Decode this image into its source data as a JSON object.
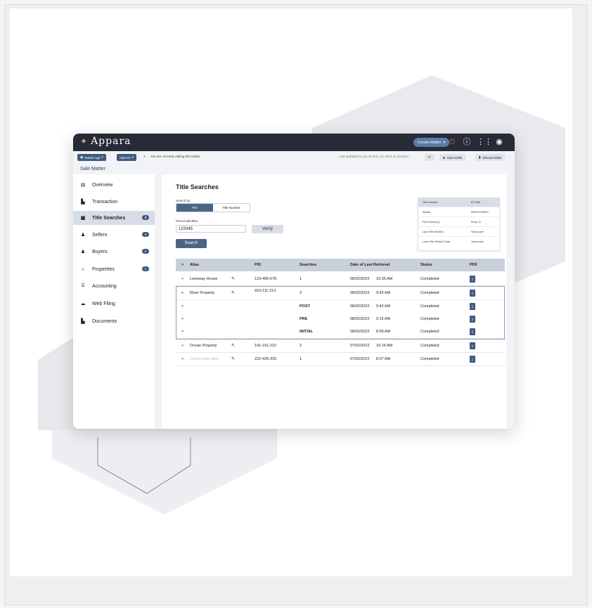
{
  "app": {
    "logo_text": "Appara",
    "create_matter_label": "Create Matter",
    "icons": [
      "timer-off-icon",
      "help-icon",
      "apps-grid-icon",
      "account-icon"
    ]
  },
  "toolbar": {
    "switch_app_label": "Switch App",
    "options_label": "Options",
    "editing_text": "You are currently editing this matter",
    "last_updated_text": "Last updated by you on Nov. 15, 2021 at 11:31pm",
    "save_edits_label": "Save Edits",
    "discard_edits_label": "Discard Edits"
  },
  "page": {
    "subtitle": "Sale Matter"
  },
  "sidebar": {
    "items": [
      {
        "label": "Overview",
        "icon": "overview-icon",
        "badge": ""
      },
      {
        "label": "Transaction",
        "icon": "transaction-icon",
        "badge": ""
      },
      {
        "label": "Title Searches",
        "icon": "title-search-icon",
        "badge": "3"
      },
      {
        "label": "Sellers",
        "icon": "sellers-icon",
        "badge": "2"
      },
      {
        "label": "Buyers",
        "icon": "buyers-icon",
        "badge": "2"
      },
      {
        "label": "Properties",
        "icon": "home-icon",
        "badge": "1"
      },
      {
        "label": "Accounting",
        "icon": "bank-icon",
        "badge": ""
      },
      {
        "label": "Web Filing",
        "icon": "cloud-icon",
        "badge": ""
      },
      {
        "label": "Documents",
        "icon": "documents-icon",
        "badge": ""
      }
    ]
  },
  "main": {
    "title": "Title Searches",
    "search_by_label": "Search by:",
    "toggle_pid": "PID",
    "toggle_title_number": "Title Number",
    "parcel_identifier_label": "Parcel Identifier:",
    "pid_value": "123345",
    "verify_label": "Verify",
    "search_label": "Search"
  },
  "info_card": {
    "rows": [
      {
        "key": "Title Number:",
        "value": "BT7898"
      },
      {
        "key": "Status:",
        "value": "REGISTERED"
      },
      {
        "key": "First Owner(s):",
        "value": "Perry, N"
      },
      {
        "key": "Land Title District:",
        "value": "Vancouver"
      },
      {
        "key": "Land Title District Code:",
        "value": "Vancouver"
      }
    ]
  },
  "table": {
    "headers": {
      "alias": "Alias",
      "pid": "PID",
      "searches": "Searches",
      "date": "Date of Last Retrieval",
      "status": "Status",
      "pdf": "PDF"
    },
    "rows": [
      {
        "chevron": ">",
        "alias": "Laneway House",
        "pid": "123-456-678",
        "searches": "1",
        "date": "08/02/2022",
        "time": "10:35 AM",
        "status": "Completed",
        "editable": true
      },
      {
        "chevron": "v",
        "alias": "River Property",
        "pid": "910-111-213",
        "searches": "3",
        "date": "08/02/2022",
        "time": "9:42 AM",
        "status": "Completed",
        "editable": true
      },
      {
        "chevron": ">",
        "alias": "",
        "pid": "",
        "searches": "POST",
        "date": "08/02/2022",
        "time": "9:42 AM",
        "status": "Completed",
        "editable": false
      },
      {
        "chevron": ">",
        "alias": "",
        "pid": "",
        "searches": "PRE",
        "date": "08/02/2022",
        "time": "9:15 AM",
        "status": "Completed",
        "editable": false
      },
      {
        "chevron": ">",
        "alias": "",
        "pid": "",
        "searches": "INITIAL",
        "date": "08/02/2022",
        "time": "8:59 AM",
        "status": "Completed",
        "editable": false
      },
      {
        "chevron": ">",
        "alias": "Ocean Property",
        "pid": "141-151-222",
        "searches": "2",
        "date": "07/02/2022",
        "time": "10:15 AM",
        "status": "Completed",
        "editable": true
      },
      {
        "chevron": ">",
        "alias": "Create new alias",
        "pid": "232-425-333",
        "searches": "1",
        "date": "07/02/2022",
        "time": "8:07 AM",
        "status": "Completed",
        "editable": true
      }
    ]
  },
  "colors": {
    "topbar": "#262b35",
    "accent": "#4b6387",
    "active_side": "#d7dde7"
  }
}
